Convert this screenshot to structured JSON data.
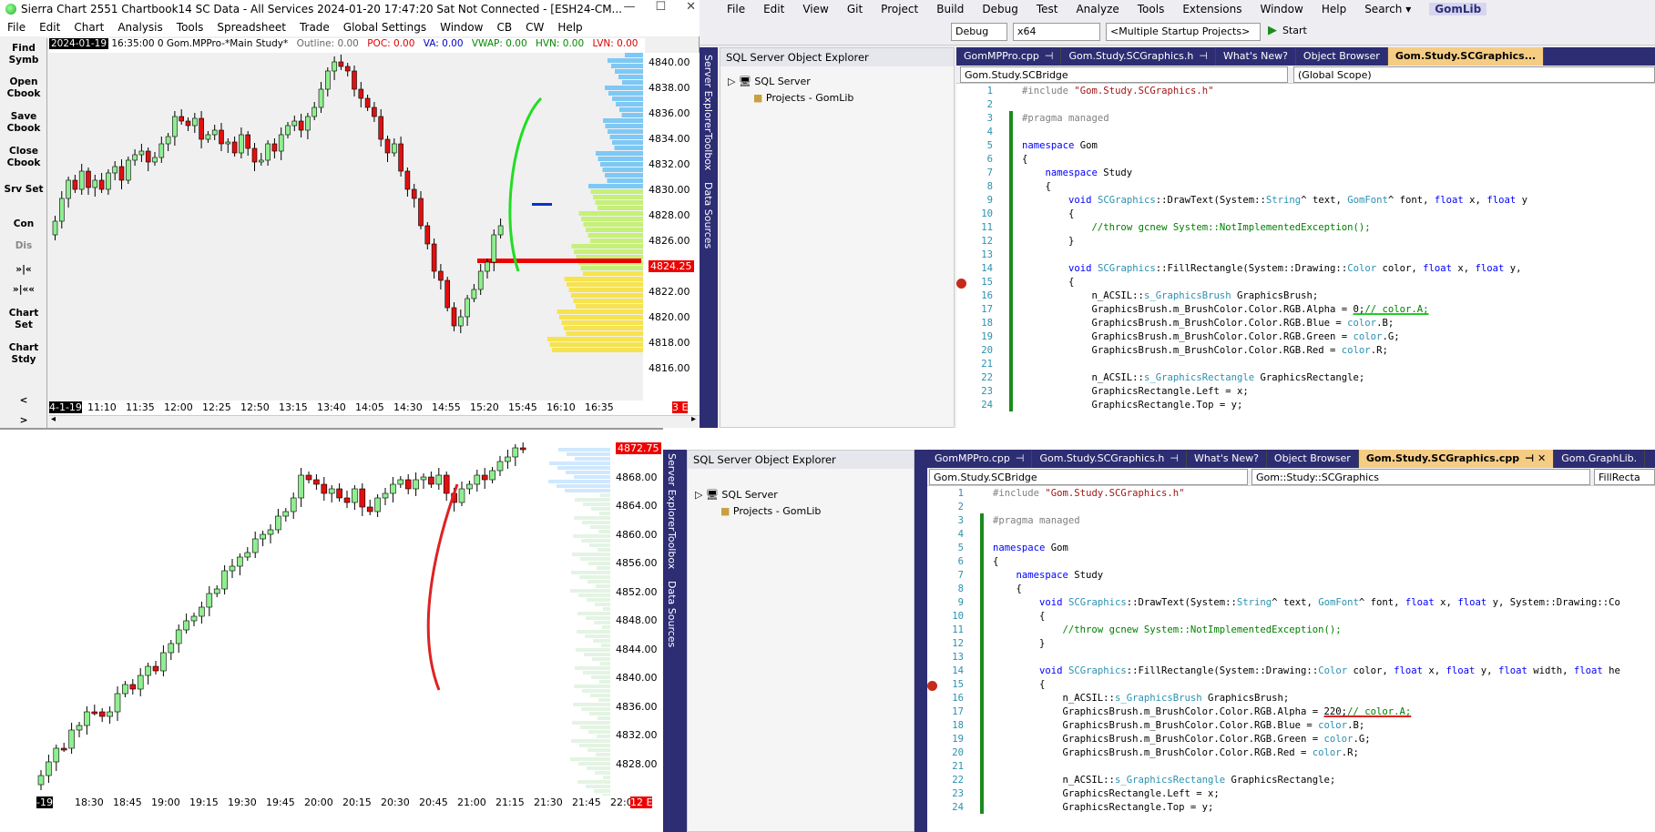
{
  "sierra": {
    "title": "Sierra Chart 2551 Chartbook14 SC Data - All Services 2024-01-20  17:47:20 Sat  Not Connected - [ESH24-CM...",
    "window_buttons": [
      "—",
      "☐",
      "✕"
    ],
    "menu": [
      "File",
      "Edit",
      "Chart",
      "Analysis",
      "Tools",
      "Spreadsheet",
      "Trade",
      "Global Settings",
      "Window",
      "CB",
      "CW",
      "Help"
    ],
    "toolbar": [
      "Find Symb",
      "Open Cbook",
      "Save Cbook",
      "Close Cbook",
      "Srv Set",
      "Con",
      "Dis",
      "»|«",
      "»|««",
      "Chart Set",
      "Chart Stdy",
      "<",
      ">"
    ],
    "chart1": {
      "date_badge": "2024-01-19",
      "header_time": "16:35:00  0 Gom.MPPro-*Main Study*",
      "outline": "Outline: 0.00",
      "poc": "POC: 0.00",
      "va": "VA: 0.00",
      "vwap": "VWAP: 0.00",
      "hvn": "HVN: 0.00",
      "lvn": "LVN: 0.00",
      "price_labels": [
        "4840.00",
        "4838.00",
        "4836.00",
        "4834.00",
        "4832.00",
        "4830.00",
        "4828.00",
        "4826.00",
        "4824.25",
        "4822.00",
        "4820.00",
        "4818.00",
        "4816.00"
      ],
      "time_labels": [
        "4-1-19",
        "11:10",
        "11:35",
        "12:00",
        "12:25",
        "12:50",
        "13:15",
        "13:40",
        "14:05",
        "14:30",
        "14:55",
        "15:20",
        "15:45",
        "16:10",
        "16:35"
      ],
      "corner_badge": "3 E"
    },
    "chart2": {
      "price_labels": [
        "4872.75",
        "4868.00",
        "4864.00",
        "4860.00",
        "4856.00",
        "4852.00",
        "4848.00",
        "4844.00",
        "4840.00",
        "4836.00",
        "4832.00",
        "4828.00"
      ],
      "time_labels": [
        "-19",
        "18:30",
        "18:45",
        "19:00",
        "19:15",
        "19:30",
        "19:45",
        "20:00",
        "20:15",
        "20:30",
        "20:45",
        "21:00",
        "21:15",
        "21:30",
        "21:45",
        "22:00"
      ],
      "corner_badge": "12 E"
    }
  },
  "vs_top": {
    "menu": [
      "File",
      "Edit",
      "View",
      "Git",
      "Project",
      "Build",
      "Debug",
      "Test",
      "Analyze",
      "Tools",
      "Extensions",
      "Window",
      "Help"
    ],
    "search": "Search ▾",
    "solution": "GomLib",
    "config": "Debug",
    "platform": "x64",
    "startup": "<Multiple Startup Projects>",
    "start": "Start",
    "side_tabs": [
      "Server Explorer",
      "Toolbox",
      "Data Sources"
    ],
    "soe": {
      "title": "SQL Server Object Explorer",
      "tree": [
        "SQL Server",
        "Projects - GomLib"
      ]
    },
    "tabs": [
      "GomMPPro.cpp",
      "Gom.Study.SCGraphics.h",
      "What's New?",
      "Object Browser",
      "Gom.Study.SCGraphics..."
    ],
    "nav_left": "Gom.Study.SCBridge",
    "nav_right": "(Global Scope)",
    "alpha_value": "0"
  },
  "vs_bottom": {
    "side_tabs": [
      "Server Explorer",
      "Toolbox",
      "Data Sources"
    ],
    "soe": {
      "title": "SQL Server Object Explorer",
      "tree": [
        "SQL Server",
        "Projects - GomLib"
      ]
    },
    "tabs": [
      "GomMPPro.cpp",
      "Gom.Study.SCGraphics.h",
      "What's New?",
      "Object Browser",
      "Gom.Study.SCGraphics.cpp",
      "Gom.GraphLib."
    ],
    "nav_left": "Gom.Study.SCBridge",
    "nav_mid": "Gom::Study::SCGraphics",
    "nav_right": "FillRecta",
    "alpha_value": "220"
  },
  "colors": {
    "up": "#90ee90",
    "down": "#e01010",
    "accent": "#f5cc84",
    "vs_dark": "#2d2d74"
  }
}
